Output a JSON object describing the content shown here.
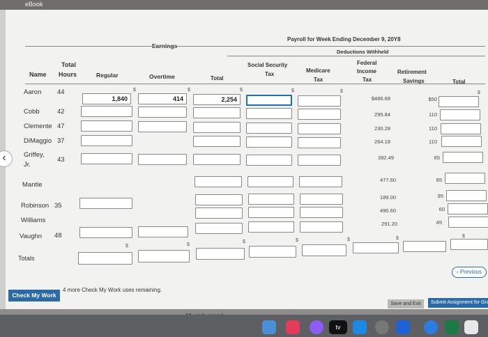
{
  "browser": {
    "tab_label": "eBook"
  },
  "header": {
    "earnings": "Earnings",
    "payroll_title": "Payroll for Week Ending December 9, 20Y8",
    "deductions": "Deductions Withheld",
    "name": "Name",
    "total_hours_1": "Total",
    "total_hours_2": "Hours",
    "regular": "Regular",
    "overtime": "Overtime",
    "total": "Total",
    "ss_1": "Social Security",
    "ss_2": "Tax",
    "medicare_1": "Medicare",
    "medicare_2": "Tax",
    "fit_1": "Federal",
    "fit_2": "Income",
    "fit_3": "Tax",
    "ret_1": "Retirement",
    "ret_2": "Savings",
    "ded_total": "Total"
  },
  "rows": [
    {
      "name": "Aaron",
      "hours": "44",
      "regular": "1,840",
      "overtime": "414",
      "total": "2,254",
      "fit": "$486.68",
      "ret": "$50"
    },
    {
      "name": "Cobb",
      "hours": "42",
      "fit": "295.84",
      "ret": "110"
    },
    {
      "name": "Clemente",
      "hours": "47",
      "fit": "230.28",
      "ret": "110"
    },
    {
      "name": "DiMaggio",
      "hours": "37",
      "fit": "264.18",
      "ret": "110"
    },
    {
      "name": "Griffey,",
      "name2": "Jr.",
      "hours": "43",
      "fit": "392.49",
      "ret": "65"
    },
    {
      "name": "Mantle",
      "hours": "",
      "fit": "477.60",
      "ret": "85"
    },
    {
      "name": "Robinson",
      "hours": "35",
      "fit": "189.00",
      "ret": "95"
    },
    {
      "name": "Williams",
      "hours": "",
      "fit": "490.60",
      "ret": "60"
    },
    {
      "name": "Vaughn",
      "hours": "48",
      "fit": "291.20",
      "ret": "45"
    }
  ],
  "totals_label": "Totals",
  "dollar": "$",
  "buttons": {
    "check": "Check My Work",
    "check_note": "4 more Check My Work uses remaining.",
    "previous": "Previous",
    "save_exit": "Save and Exit",
    "submit": "Submit Assignment for Grading"
  },
  "status": {
    "saved": "All work saved."
  },
  "dock": {
    "tv_label": "tv"
  }
}
